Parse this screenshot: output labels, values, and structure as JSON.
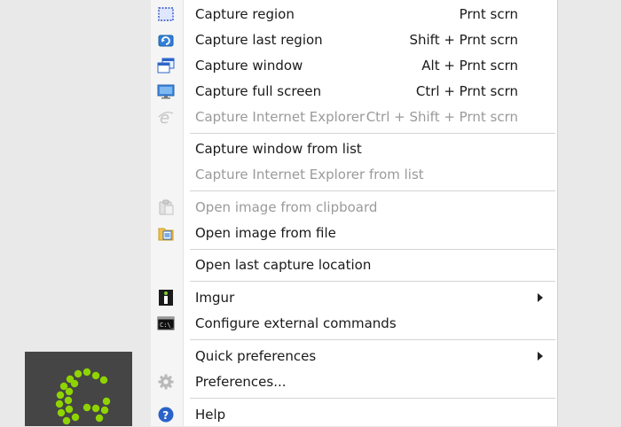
{
  "menu": {
    "items": [
      {
        "label": "Capture region",
        "shortcut": "Prnt scrn",
        "icon": "capture-region-icon",
        "enabled": true
      },
      {
        "label": "Capture last region",
        "shortcut": "Shift + Prnt scrn",
        "icon": "capture-last-region-icon",
        "enabled": true
      },
      {
        "label": "Capture window",
        "shortcut": "Alt + Prnt scrn",
        "icon": "capture-window-icon",
        "enabled": true
      },
      {
        "label": "Capture full screen",
        "shortcut": "Ctrl + Prnt scrn",
        "icon": "monitor-icon",
        "enabled": true
      },
      {
        "label": "Capture Internet Explorer",
        "shortcut": "Ctrl + Shift + Prnt scrn",
        "icon": "internet-explorer-icon",
        "enabled": false
      },
      {
        "label": "Capture window from list",
        "shortcut": "",
        "icon": "",
        "enabled": true
      },
      {
        "label": "Capture Internet Explorer from list",
        "shortcut": "",
        "icon": "",
        "enabled": false
      },
      {
        "label": "Open image from clipboard",
        "shortcut": "",
        "icon": "clipboard-icon",
        "enabled": false
      },
      {
        "label": "Open image from file",
        "shortcut": "",
        "icon": "open-file-icon",
        "enabled": true
      },
      {
        "label": "Open last capture location",
        "shortcut": "",
        "icon": "",
        "enabled": true
      },
      {
        "label": "Imgur",
        "shortcut": "",
        "icon": "imgur-icon",
        "enabled": true,
        "submenu": true
      },
      {
        "label": "Configure external commands",
        "shortcut": "",
        "icon": "command-prompt-icon",
        "enabled": true
      },
      {
        "label": "Quick preferences",
        "shortcut": "",
        "icon": "",
        "enabled": true,
        "submenu": true
      },
      {
        "label": "Preferences...",
        "shortcut": "",
        "icon": "gear-icon",
        "enabled": true
      },
      {
        "label": "Help",
        "shortcut": "",
        "icon": "help-icon",
        "enabled": true
      }
    ]
  },
  "colors": {
    "menu_background": "#ffffff",
    "gutter": "#f5f5f5",
    "disabled_text": "#9a9a9a",
    "greenshot_green": "#8fd400",
    "logo_background": "#454545",
    "help_blue": "#2a62c9"
  }
}
